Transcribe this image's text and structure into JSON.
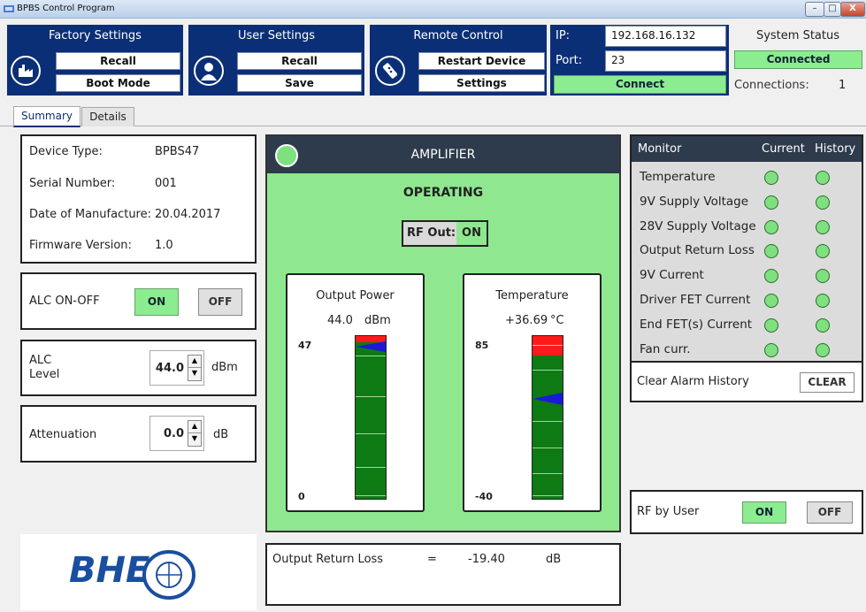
{
  "window": {
    "title": "BPBS Control Program",
    "min": "–",
    "max": "□",
    "close": "X"
  },
  "factory": {
    "title": "Factory Settings",
    "recall": "Recall",
    "boot": "Boot Mode",
    "icon": "factory-icon"
  },
  "user": {
    "title": "User Settings",
    "recall": "Recall",
    "save": "Save",
    "icon": "user-icon"
  },
  "remote": {
    "title": "Remote Control",
    "restart": "Restart Device",
    "settings": "Settings",
    "icon": "remote-icon"
  },
  "network": {
    "ip_label": "IP:",
    "ip_value": "192.168.16.132",
    "port_label": "Port:",
    "port_value": "23",
    "connect": "Connect"
  },
  "system_status": {
    "title": "System Status",
    "state": "Connected",
    "connections_label": "Connections:",
    "connections_value": "1"
  },
  "tabs": [
    {
      "label": "Summary",
      "active": true
    },
    {
      "label": "Details",
      "active": false
    }
  ],
  "device": {
    "rows": [
      {
        "label": "Device Type:",
        "value": "BPBS47"
      },
      {
        "label": "Serial Number:",
        "value": "001"
      },
      {
        "label": "Date of Manufacture:",
        "value": "20.04.2017"
      },
      {
        "label": "Firmware Version:",
        "value": "1.0"
      }
    ]
  },
  "alc": {
    "label": "ALC ON-OFF",
    "on": "ON",
    "off": "OFF"
  },
  "alc_level": {
    "label1": "ALC",
    "label2": "Level",
    "value": "44.0",
    "unit": "dBm"
  },
  "attenuation": {
    "label": "Attenuation",
    "value": "0.0",
    "unit": "dB"
  },
  "logo": {
    "text": "BHE"
  },
  "amplifier": {
    "title": "AMPLIFIER",
    "state": "OPERATING",
    "rf_label": "RF Out:",
    "rf_value": "ON",
    "power": {
      "title": "Output Power",
      "value": "44.0",
      "unit": "dBm",
      "max": "47",
      "min": "0",
      "level": 44.0,
      "range": [
        0,
        47
      ]
    },
    "temp": {
      "title": "Temperature",
      "value": "+36.69",
      "unit": "°C",
      "max": "85",
      "min": "-40",
      "level": 36.69,
      "range": [
        -40,
        85
      ]
    }
  },
  "return_loss": {
    "label": "Output Return Loss",
    "eq": "=",
    "value": "-19.40",
    "unit": "dB"
  },
  "monitor": {
    "h_monitor": "Monitor",
    "h_current": "Current",
    "h_history": "History",
    "rows": [
      "Temperature",
      "9V Supply Voltage",
      "28V Supply Voltage",
      "Output Return Loss",
      "9V Current",
      "Driver FET Current",
      "End FET(s) Current",
      "Fan curr."
    ]
  },
  "alarm": {
    "label": "Clear Alarm History",
    "button": "CLEAR"
  },
  "rf_user": {
    "label": "RF by User",
    "on": "ON",
    "off": "OFF"
  },
  "colors": {
    "header_blue": "#0b2f76",
    "led_green": "#7fe07f",
    "status_green": "#8cec90",
    "amp_green": "#8fe88f",
    "bar_green": "#0e7a14",
    "marker_blue": "#1a1ad6",
    "alarm_red": "#ff1a1a"
  }
}
